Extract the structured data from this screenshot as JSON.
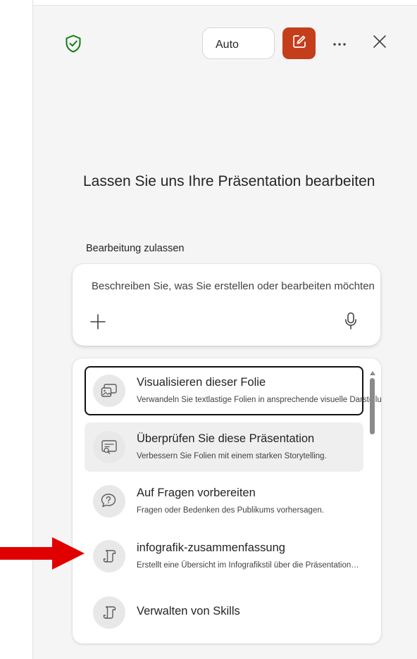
{
  "header": {
    "mode_label": "Auto",
    "icons": {
      "shield": "shield-check-icon",
      "compose": "compose-icon",
      "more": "more-horizontal-icon",
      "close": "close-icon"
    }
  },
  "main": {
    "heading": "Lassen Sie uns Ihre Präsentation bearbeiten",
    "section_label": "Bearbeitung zulassen",
    "prompt": {
      "placeholder": "Beschreiben Sie, was Sie erstellen oder bearbeiten möchten"
    }
  },
  "suggestions": [
    {
      "title": "Visualisieren dieser Folie",
      "description": "Verwandeln Sie textlastige Folien in ansprechende visuelle Darstellungen.",
      "icon": "slide-image-icon",
      "state": "focused"
    },
    {
      "title": "Überprüfen Sie diese Präsentation",
      "description": "Verbessern Sie Folien mit einem starken Storytelling.",
      "icon": "slide-search-icon",
      "state": "hovered"
    },
    {
      "title": "Auf Fragen vorbereiten",
      "description": "Fragen oder Bedenken des Publikums vorhersagen.",
      "icon": "chat-question-icon",
      "state": "normal"
    },
    {
      "title": "infografik-zusammenfassung",
      "description": "Erstellt eine Übersicht im Infografikstil über die Präsentation…",
      "icon": "scroll-icon",
      "state": "normal"
    },
    {
      "title": "Verwalten von Skills",
      "description": "",
      "icon": "scroll-icon",
      "state": "normal"
    }
  ],
  "colors": {
    "accent": "#c43e1c",
    "shield": "#107c10",
    "arrow": "#e00000"
  }
}
